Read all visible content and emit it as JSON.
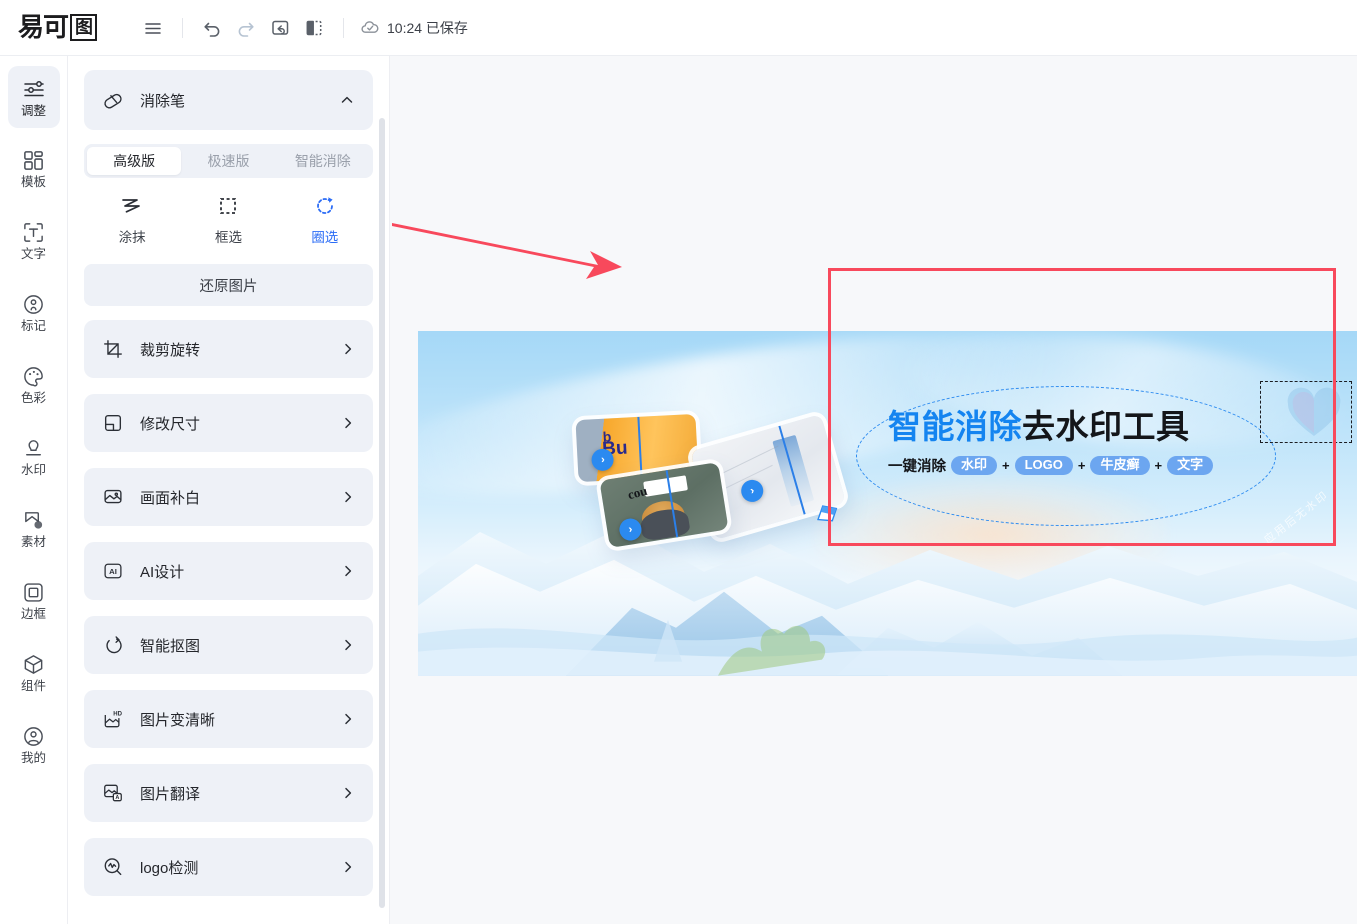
{
  "header": {
    "logo_text": "易可图",
    "logo_chars": [
      "易",
      "可",
      "图"
    ],
    "menu_label": "菜单",
    "undo_label": "撤销",
    "redo_label": "重做",
    "reset_label": "重置",
    "compare_label": "对比",
    "save_time": "10:24",
    "save_state": "已保存",
    "save_status": "10:24 已保存"
  },
  "rail": {
    "items": [
      {
        "label": "调整",
        "icon": "sliders-icon",
        "active": true
      },
      {
        "label": "模板",
        "icon": "template-icon",
        "active": false
      },
      {
        "label": "文字",
        "icon": "text-icon",
        "active": false
      },
      {
        "label": "标记",
        "icon": "mark-icon",
        "active": false
      },
      {
        "label": "色彩",
        "icon": "palette-icon",
        "active": false
      },
      {
        "label": "水印",
        "icon": "watermark-icon",
        "active": false
      },
      {
        "label": "素材",
        "icon": "material-icon",
        "active": false
      },
      {
        "label": "边框",
        "icon": "border-icon",
        "active": false
      },
      {
        "label": "组件",
        "icon": "component-icon",
        "active": false
      },
      {
        "label": "我的",
        "icon": "user-icon",
        "active": false
      }
    ]
  },
  "panel": {
    "eraser": {
      "title": "消除笔",
      "icon": "eraser-icon",
      "collapse_icon": "chevron-up-icon",
      "tabs": [
        {
          "label": "高级版",
          "active": true
        },
        {
          "label": "极速版",
          "active": false
        },
        {
          "label": "智能消除",
          "active": false
        }
      ],
      "modes": [
        {
          "label": "涂抹",
          "icon": "brush-icon",
          "active": false
        },
        {
          "label": "框选",
          "icon": "rect-select-icon",
          "active": false
        },
        {
          "label": "圈选",
          "icon": "lasso-select-icon",
          "active": true
        }
      ],
      "restore_label": "还原图片"
    },
    "tools": [
      {
        "label": "裁剪旋转",
        "icon": "crop-rotate-icon"
      },
      {
        "label": "修改尺寸",
        "icon": "resize-icon"
      },
      {
        "label": "画面补白",
        "icon": "fill-icon"
      },
      {
        "label": "AI设计",
        "icon": "ai-design-icon"
      },
      {
        "label": "智能抠图",
        "icon": "cutout-icon"
      },
      {
        "label": "图片变清晰",
        "icon": "hd-icon"
      },
      {
        "label": "图片翻译",
        "icon": "translate-icon"
      },
      {
        "label": "logo检测",
        "icon": "logo-detect-icon"
      }
    ]
  },
  "canvas": {
    "banner": {
      "headline_blue": "智能消除",
      "headline_dark": "去水印工具",
      "sub_lead": "一键消除",
      "sub_pills": [
        "水印",
        "LOGO",
        "牛皮癣",
        "文字"
      ],
      "plus": "+",
      "watermark_text": "应用后无水印"
    },
    "cards": [
      {
        "name": "card-drink-before-after",
        "badge": ">"
      },
      {
        "name": "card-document-before-after",
        "badge": ">"
      },
      {
        "name": "card-photo-before-after",
        "badge": ">"
      }
    ],
    "annotations": [
      {
        "name": "red-arrow",
        "type": "arrow",
        "color": "#f8495c"
      },
      {
        "name": "red-highlight-rect",
        "type": "rect",
        "color": "#f8495c"
      }
    ]
  },
  "colors": {
    "accent_blue": "#2b6cf6",
    "headline_blue": "#1484f0",
    "pill_blue": "#6ca6f0",
    "annotation_red": "#f8495c",
    "panel_bg": "#eef1f7",
    "canvas_bg": "#f7f8fa"
  }
}
